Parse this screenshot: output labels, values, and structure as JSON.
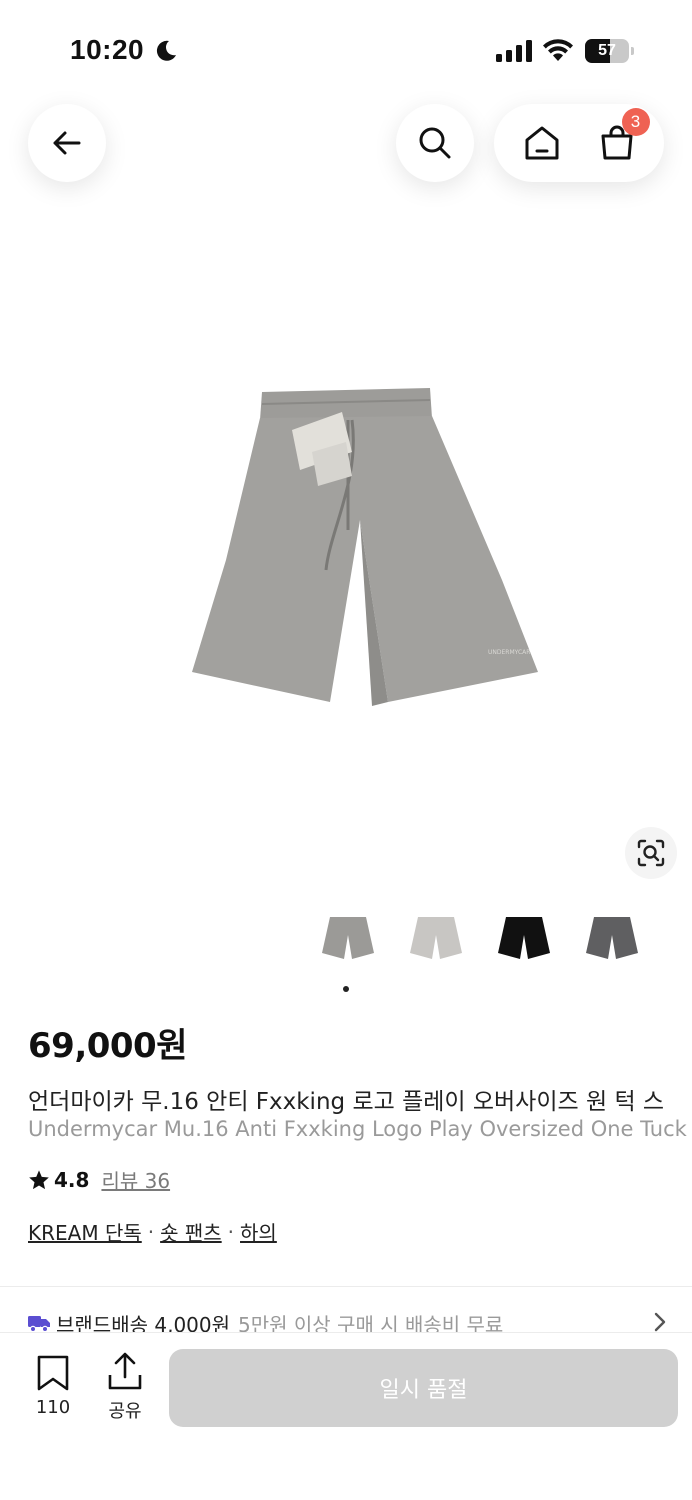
{
  "status_bar": {
    "time": "10:20",
    "battery": "57",
    "battery_level": 0.57,
    "icons": [
      "moon-icon",
      "signal-icon",
      "wifi-icon",
      "battery-icon"
    ]
  },
  "nav": {
    "back_icon": "arrow-left-icon",
    "search_icon": "search-icon",
    "home_icon": "home-icon",
    "cart_icon": "shopping-bag-icon",
    "cart_count": "3"
  },
  "gallery": {
    "current_index": 0,
    "thumbnails": [
      {
        "color": "#9b9a97",
        "name": "gray"
      },
      {
        "color": "#c8c6c3",
        "name": "light gray"
      },
      {
        "color": "#111111",
        "name": "black"
      },
      {
        "color": "#5f5f61",
        "name": "charcoal"
      }
    ]
  },
  "product": {
    "price": "69,000원",
    "title_ko": "언더마이카 무.16 안티 Fxxking 로고 플레이 오버사이즈 원 턱 스",
    "title_en": "Undermycar Mu.16 Anti Fxxking Logo Play Oversized One Tuck",
    "rating": "4.8",
    "review_label": "리뷰 36",
    "tags": [
      "KREAM 단독",
      "숏 팬츠",
      "하의"
    ],
    "tag_separator": "·"
  },
  "delivery": {
    "main": "브랜드배송 4,000원",
    "sub": "5만원 이상 구매 시 배송비 무료"
  },
  "bottom_bar": {
    "bookmark_count": "110",
    "share_label": "공유",
    "cta_label": "일시 품절"
  },
  "colors": {
    "badge": "#ef6253",
    "cta_disabled": "#d0d0d0",
    "delivery_truck": "#5b4ed1",
    "subtle_text": "#9a9a9a"
  }
}
